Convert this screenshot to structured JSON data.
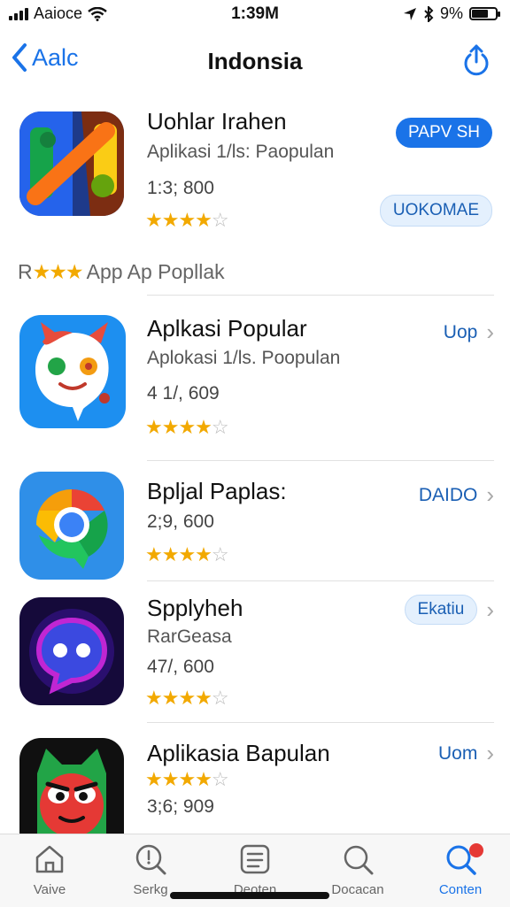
{
  "status": {
    "carrier": "Aaioce",
    "time": "1:39M",
    "battery": "9%"
  },
  "nav": {
    "back_label": "Aalc",
    "title": "Indonsia"
  },
  "apps": [
    {
      "name": "Uohlar Irahen",
      "subtitle": "Aplikasi 1/ls: Paopulan",
      "count": "1:3; 800",
      "rating": "4.5",
      "primary_button": "PAPV SH",
      "secondary_button": "UOKOMAE",
      "icon": "orange-green-blocks-app-icon"
    }
  ],
  "section": {
    "prefix": "R",
    "label": "App Ap Popllak"
  },
  "list": [
    {
      "name": "Aplkasi Popular",
      "subtitle": "Aplokasi 1/ls. Poopulan",
      "count": "4 1/, 609",
      "action": "Uop",
      "icon": "red-cat-app-icon"
    },
    {
      "name": "Bpljal Paplas:",
      "count": "2;9, 600",
      "action": "DAIDO",
      "icon": "chrome-chat-app-icon"
    },
    {
      "name": "Spplyheh",
      "subtitle": "RarGeasa",
      "count": "47/, 600",
      "action": "Ekatiu",
      "icon": "purple-chat-app-icon"
    },
    {
      "name": "Aplikasia Bapulan",
      "count": "3;6; 909",
      "action": "Uom",
      "icon": "green-red-monster-app-icon"
    }
  ],
  "tabs": [
    {
      "label": "Vaive",
      "icon": "home-icon"
    },
    {
      "label": "Serkg",
      "icon": "search-circle-icon"
    },
    {
      "label": "Deoten",
      "icon": "list-icon"
    },
    {
      "label": "Docacan",
      "icon": "magnifier-icon"
    },
    {
      "label": "Conten",
      "icon": "search-active-icon"
    }
  ],
  "colors": {
    "accent": "#1a73e8",
    "star": "#f2a900"
  }
}
